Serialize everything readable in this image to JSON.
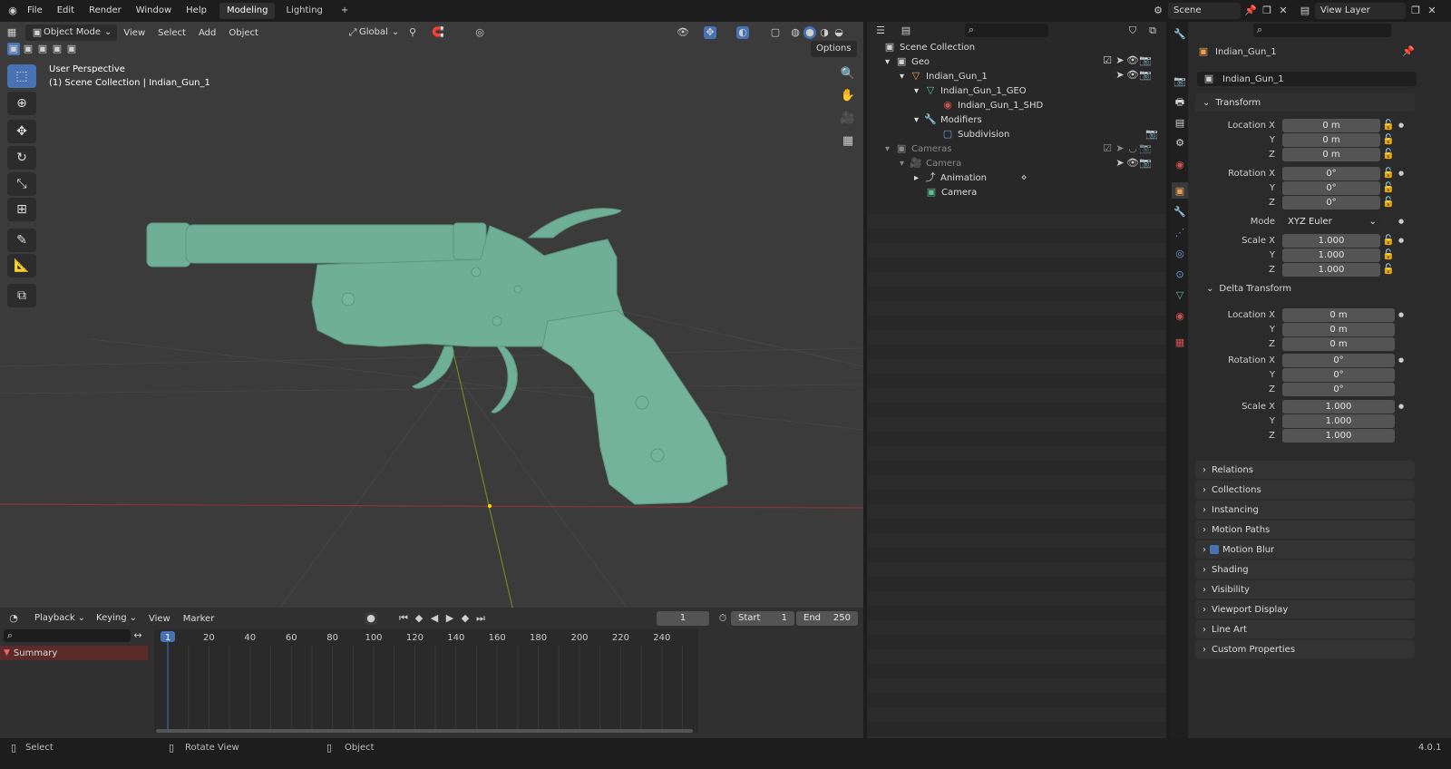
{
  "menu": {
    "file": "File",
    "edit": "Edit",
    "render": "Render",
    "window": "Window",
    "help": "Help"
  },
  "workspaces": {
    "active": "Modeling",
    "other": "Lighting",
    "add": "+"
  },
  "scene": {
    "label": "Scene",
    "view_layer": "View Layer"
  },
  "viewport": {
    "mode": "Object Mode",
    "view": "View",
    "select": "Select",
    "add": "Add",
    "object": "Object",
    "orientation": "Global",
    "options": "Options",
    "overlay_title": "User Perspective",
    "overlay_sub": "(1) Scene Collection | Indian_Gun_1"
  },
  "timeline": {
    "playback": "Playback",
    "keying": "Keying",
    "view": "View",
    "marker": "Marker",
    "current_frame": "1",
    "start_label": "Start",
    "start": "1",
    "end_label": "End",
    "end": "250",
    "ruler": [
      "1",
      "20",
      "40",
      "60",
      "80",
      "100",
      "120",
      "140",
      "160",
      "180",
      "200",
      "220",
      "240"
    ],
    "summary": "Summary"
  },
  "outliner": {
    "scene_collection": "Scene Collection",
    "rows": [
      {
        "label": "Geo"
      },
      {
        "label": "Indian_Gun_1"
      },
      {
        "label": "Indian_Gun_1_GEO"
      },
      {
        "label": "Indian_Gun_1_SHD"
      },
      {
        "label": "Modifiers"
      },
      {
        "label": "Subdivision"
      },
      {
        "label": "Cameras"
      },
      {
        "label": "Camera"
      },
      {
        "label": "Animation"
      },
      {
        "label": "Camera"
      }
    ]
  },
  "properties": {
    "object_name": "Indian_Gun_1",
    "name_field": "Indian_Gun_1",
    "transform": "Transform",
    "location_x_label": "Location X",
    "y": "Y",
    "z": "Z",
    "location": [
      "0 m",
      "0 m",
      "0 m"
    ],
    "rotation_x_label": "Rotation X",
    "rotation": [
      "0°",
      "0°",
      "0°"
    ],
    "mode_label": "Mode",
    "mode": "XYZ Euler",
    "scale_x_label": "Scale X",
    "scale": [
      "1.000",
      "1.000",
      "1.000"
    ],
    "delta_transform": "Delta Transform",
    "delta_location": [
      "0 m",
      "0 m",
      "0 m"
    ],
    "delta_rotation": [
      "0°",
      "0°",
      "0°"
    ],
    "delta_scale": [
      "1.000",
      "1.000",
      "1.000"
    ],
    "panels": [
      "Relations",
      "Collections",
      "Instancing",
      "Motion Paths",
      "Motion Blur",
      "Shading",
      "Visibility",
      "Viewport Display",
      "Line Art",
      "Custom Properties"
    ]
  },
  "status": {
    "select": "Select",
    "rotate": "Rotate View",
    "object": "Object",
    "version": "4.0.1"
  },
  "colors": {
    "accent": "#4772b3",
    "mesh": "#6fae97",
    "axis_x": "#a13a3a",
    "axis_y": "#7a9a2a"
  }
}
